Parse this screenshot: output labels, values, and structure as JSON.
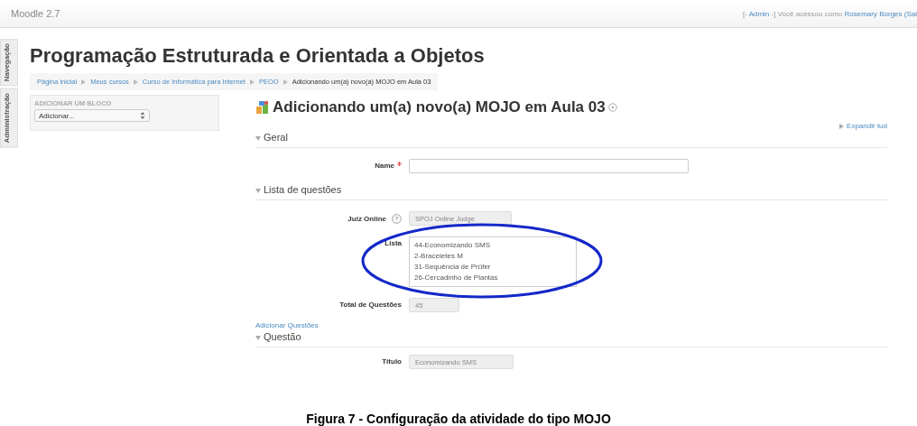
{
  "topbar": {
    "brand": "Moodle 2.7",
    "login": [
      {
        "text": "[-",
        "link": false
      },
      {
        "text": "Admin",
        "link": true
      },
      {
        "text": "-] Você acessou como",
        "link": false
      },
      {
        "text": "Rosemary Borges (Sai",
        "link": true
      }
    ]
  },
  "side_tabs": [
    {
      "label": "Navegação"
    },
    {
      "label": "Administração"
    }
  ],
  "course_title": "Programação Estruturada e Orientada a Objetos",
  "breadcrumb": [
    {
      "label": "Página inicial",
      "link": true
    },
    {
      "label": "Meus cursos",
      "link": true
    },
    {
      "label": "Curso de Informática para Internet",
      "link": true
    },
    {
      "label": "PEOO",
      "link": true
    },
    {
      "label": "Adicionando um(a) novo(a) MOJO em Aula 03",
      "link": false
    }
  ],
  "block": {
    "title": "ADICIONAR UM BLOCO",
    "select": "Adicionar..."
  },
  "page_heading": "Adicionando um(a) novo(a) MOJO em Aula 03",
  "expand_link": "Expandir tud",
  "sections": [
    {
      "title": "Geral",
      "expanded": true,
      "fields": [
        {
          "kind": "text",
          "label": "Name",
          "required": true,
          "help": false
        }
      ]
    },
    {
      "title": "Lista de questões",
      "expanded": true,
      "fields": [
        {
          "kind": "disabled",
          "label": "Juiz Online",
          "required": false,
          "help": true,
          "value": "SPOJ Online Judge"
        },
        {
          "kind": "list",
          "label": "Lista",
          "required": false,
          "help": false,
          "items": [
            "44-Economizando SMS",
            "2-Braceletes M",
            "31-Sequência de Prüfer",
            "26-Cercadinho de Plantas"
          ],
          "annotated": true
        },
        {
          "kind": "disabled",
          "label": "Total de Questões",
          "required": false,
          "help": false,
          "value": "45"
        },
        {
          "kind": "link",
          "label": "Adicionar Questões"
        }
      ]
    },
    {
      "title": "Questão",
      "expanded": true,
      "fields": [
        {
          "kind": "disabled",
          "label": "Título",
          "required": false,
          "help": false,
          "value": "Economizando SMS"
        }
      ]
    }
  ],
  "caption": "Figura 7 - Configuração da atividade do tipo MOJO"
}
